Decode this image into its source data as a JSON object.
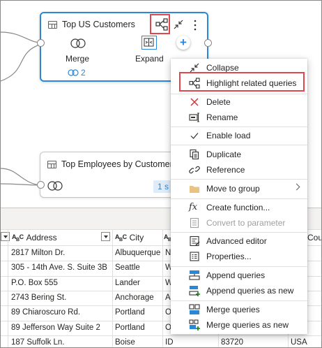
{
  "colors": {
    "accent": "#2b88d8",
    "highlight_box": "#e0474c",
    "delete_red": "#d13438",
    "folder_yellow": "#eac282",
    "badge_bg": "#deecf9"
  },
  "diagram": {
    "top_query": {
      "title": "Top US Customers",
      "steps": [
        {
          "label": "Merge",
          "icon": "merge-icon",
          "link_count": "2"
        },
        {
          "label": "Expand",
          "icon": "expand-icon"
        }
      ],
      "header_icons": [
        "related-queries-icon",
        "collapse-arrows-icon",
        "more-options-icon"
      ],
      "add_step": "+"
    },
    "second_query": {
      "title": "Top Employees by Customers",
      "badge": "1 s",
      "step_icon": "merge-icon"
    }
  },
  "grid": {
    "columns": [
      {
        "type": "ABC",
        "name": "Address"
      },
      {
        "type": "ABC",
        "name": "City"
      },
      {
        "type": "ABC",
        "name": ""
      },
      {
        "type": "",
        "name": "Coun"
      }
    ],
    "rows": [
      {
        "address": "2817 Milton Dr.",
        "city": "Albuquerque",
        "state": "N",
        "zip": "",
        "country": ""
      },
      {
        "address": "305 - 14th Ave. S. Suite 3B",
        "city": "Seattle",
        "state": "W",
        "zip": "",
        "country": ""
      },
      {
        "address": "P.O. Box 555",
        "city": "Lander",
        "state": "W",
        "zip": "",
        "country": ""
      },
      {
        "address": "2743 Bering St.",
        "city": "Anchorage",
        "state": "A",
        "zip": "",
        "country": ""
      },
      {
        "address": "89 Chiaroscuro Rd.",
        "city": "Portland",
        "state": "O",
        "zip": "",
        "country": ""
      },
      {
        "address": "89 Jefferson Way Suite 2",
        "city": "Portland",
        "state": "O",
        "zip": "",
        "country": ""
      },
      {
        "address": "187 Suffolk Ln.",
        "city": "Boise",
        "state": "ID",
        "zip": "83720",
        "country": "USA"
      }
    ]
  },
  "context_menu": {
    "items": [
      {
        "label": "Collapse",
        "icon": "collapse-arrows-icon"
      },
      {
        "label": "Highlight related queries",
        "icon": "related-queries-icon"
      },
      {
        "label": "Delete",
        "icon": "delete-x-icon"
      },
      {
        "label": "Rename",
        "icon": "rename-icon"
      },
      {
        "label": "Enable load",
        "icon": "checkmark-icon"
      },
      {
        "label": "Duplicate",
        "icon": "duplicate-icon"
      },
      {
        "label": "Reference",
        "icon": "reference-icon"
      },
      {
        "label": "Move to group",
        "icon": "folder-icon"
      },
      {
        "label": "Create function...",
        "icon": "function-icon"
      },
      {
        "label": "Convert to parameter",
        "icon": "parameter-icon"
      },
      {
        "label": "Advanced editor",
        "icon": "advanced-editor-icon"
      },
      {
        "label": "Properties...",
        "icon": "properties-icon"
      },
      {
        "label": "Append queries",
        "icon": "append-queries-icon"
      },
      {
        "label": "Append queries as new",
        "icon": "append-queries-new-icon"
      },
      {
        "label": "Merge queries",
        "icon": "merge-queries-icon"
      },
      {
        "label": "Merge queries as new",
        "icon": "merge-queries-new-icon"
      }
    ]
  }
}
